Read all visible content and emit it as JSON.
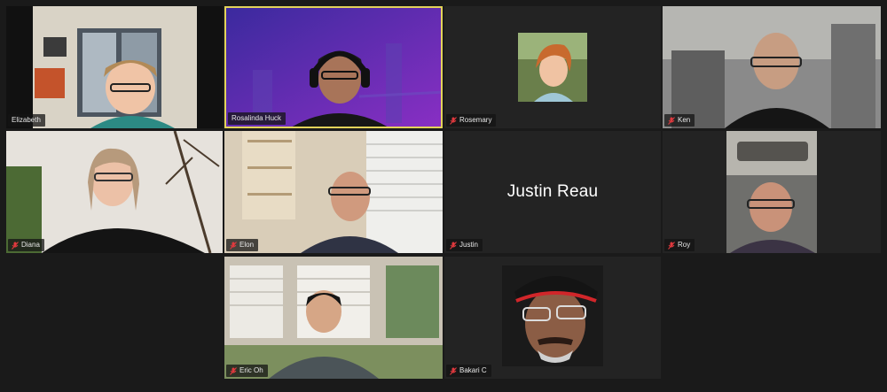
{
  "participants": [
    {
      "name": "Elizabeth",
      "muted": false
    },
    {
      "name": "Rosalinda Huck",
      "muted": false,
      "active_speaker": true
    },
    {
      "name": "Rosemary",
      "muted": true
    },
    {
      "name": "Ken",
      "muted": true
    },
    {
      "name": "Diana",
      "muted": true
    },
    {
      "name": "Elon",
      "muted": true
    },
    {
      "name": "Justin",
      "muted": true,
      "display_name_large": "Justin Reau"
    },
    {
      "name": "Roy",
      "muted": true
    },
    {
      "name": "Eric Oh",
      "muted": true
    },
    {
      "name": "Bakari C",
      "muted": true
    }
  ],
  "colors": {
    "background": "#1a1a1a",
    "tile": "#232323",
    "active_border": "#e3d35a",
    "mute_icon": "#e0393e"
  }
}
